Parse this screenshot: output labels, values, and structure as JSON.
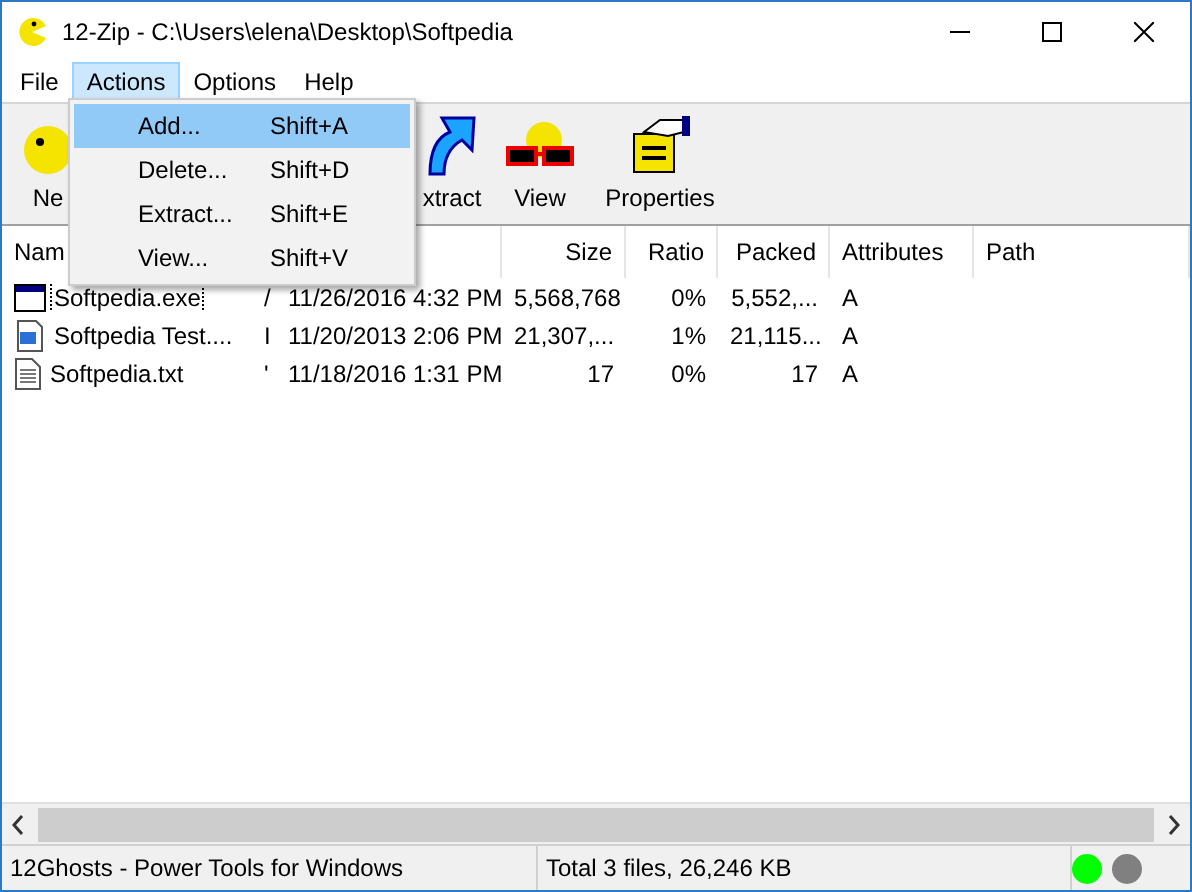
{
  "window": {
    "title": "12-Zip - C:\\Users\\elena\\Desktop\\Softpedia"
  },
  "menu_bar": [
    {
      "label": "File",
      "selected": false
    },
    {
      "label": "Actions",
      "selected": true
    },
    {
      "label": "Options",
      "selected": false
    },
    {
      "label": "Help",
      "selected": false
    }
  ],
  "actions_menu": [
    {
      "label": "Add...",
      "shortcut": "Shift+A",
      "selected": true
    },
    {
      "label": "Delete...",
      "shortcut": "Shift+D",
      "selected": false
    },
    {
      "label": "Extract...",
      "shortcut": "Shift+E",
      "selected": false
    },
    {
      "label": "View...",
      "shortcut": "Shift+V",
      "selected": false
    }
  ],
  "toolbar": [
    {
      "kind": "new",
      "label": "Ne"
    },
    {
      "kind": "add"
    },
    {
      "kind": "delete"
    },
    {
      "kind": "extract",
      "label": "xtract"
    },
    {
      "kind": "view",
      "label": "View"
    },
    {
      "kind": "properties",
      "label": "Properties"
    }
  ],
  "table": {
    "columns": [
      "Nam",
      "",
      "",
      "Size",
      "Ratio",
      "Packed",
      "Attributes",
      "Path"
    ],
    "rows": [
      {
        "kind": "exe",
        "focused": true,
        "cells": [
          "Softpedia.exe",
          "/",
          "11/26/2016 4:32 PM",
          "5,568,768",
          "0%",
          "5,552,...",
          "A",
          ""
        ]
      },
      {
        "kind": "doc",
        "focused": false,
        "cells": [
          "Softpedia Test....",
          "I",
          "11/20/2013 2:06 PM",
          "21,307,...",
          "1%",
          "21,115...",
          "A",
          ""
        ]
      },
      {
        "kind": "txt",
        "focused": false,
        "cells": [
          "Softpedia.txt",
          "'",
          "11/18/2016 1:31 PM",
          "17",
          "0%",
          "17",
          "A",
          ""
        ]
      }
    ]
  },
  "status_bar": {
    "left": "12Ghosts - Power Tools for Windows",
    "middle": "Total 3 files, 26,246 KB",
    "lights": [
      {
        "color": "#00ff00"
      },
      {
        "color": "#808080"
      }
    ]
  }
}
